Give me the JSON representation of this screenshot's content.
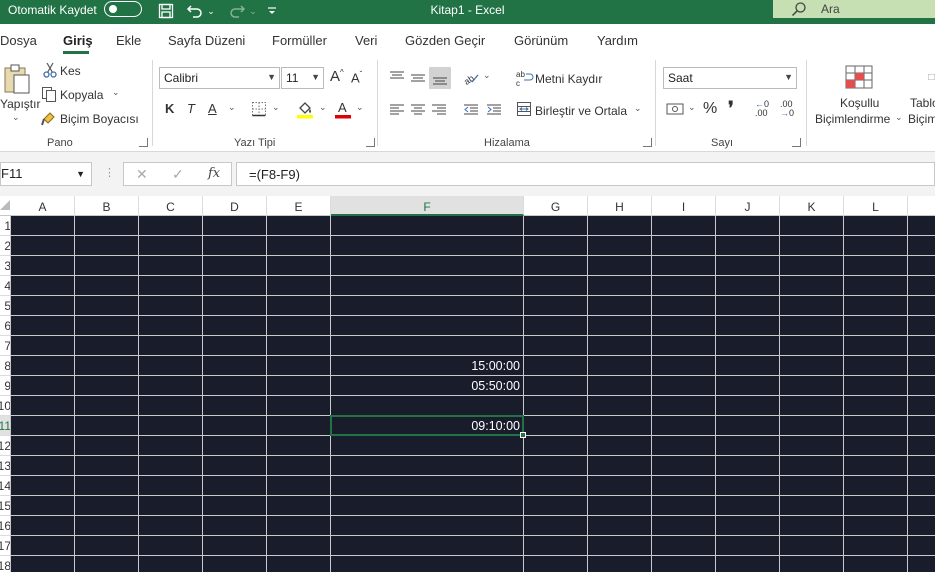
{
  "titlebar": {
    "autosave_label": "Otomatik Kaydet",
    "title": "Kitap1  -  Excel",
    "search_label": "Ara",
    "bg_color": "#217346"
  },
  "tabs": [
    "Dosya",
    "Giriş",
    "Ekle",
    "Sayfa Düzeni",
    "Formüller",
    "Veri",
    "Gözden Geçir",
    "Görünüm",
    "Yardım"
  ],
  "active_tab": "Giriş",
  "ribbon": {
    "clipboard": {
      "paste": "Yapıştır",
      "cut": "Kes",
      "copy": "Kopyala",
      "format_painter": "Biçim Boyacısı",
      "label": "Pano"
    },
    "font": {
      "name": "Calibri",
      "size": "11",
      "grow": "A",
      "shrink": "A",
      "bold": "K",
      "italic": "T",
      "underline": "A",
      "font_color_glyph": "A",
      "label": "Yazı Tipi"
    },
    "alignment": {
      "wrap_text": "Metni Kaydır",
      "merge_center": "Birleştir ve Ortala",
      "label": "Hizalama"
    },
    "number": {
      "format": "Saat",
      "percent": "%",
      "comma": "❜",
      "inc_decimal": ".00",
      "dec_decimal": ".00",
      "label": "Sayı"
    },
    "styles": {
      "conditional_line1": "Koşullu",
      "conditional_line2": "Biçimlendirme",
      "table_line1": "Tablo",
      "table_line2": "Biçim"
    }
  },
  "formula_bar": {
    "name_box": "F11",
    "fx": "fx",
    "formula": "=(F8-F9)"
  },
  "grid": {
    "columns": [
      "A",
      "B",
      "C",
      "D",
      "E",
      "F",
      "G",
      "H",
      "I",
      "J",
      "K",
      "L"
    ],
    "selected_column": "F",
    "rows": [
      "1",
      "2",
      "3",
      "4",
      "5",
      "6",
      "7",
      "8",
      "9",
      "10",
      "11",
      "12",
      "13",
      "14",
      "15",
      "16",
      "17",
      "18"
    ],
    "selected_row": "11",
    "cells": [
      {
        "ref": "F8",
        "value": "15:00:00"
      },
      {
        "ref": "F9",
        "value": "05:50:00"
      },
      {
        "ref": "F11",
        "value": "09:10:00"
      }
    ],
    "background_color": "#191c2b",
    "accent_color": "#217346"
  }
}
